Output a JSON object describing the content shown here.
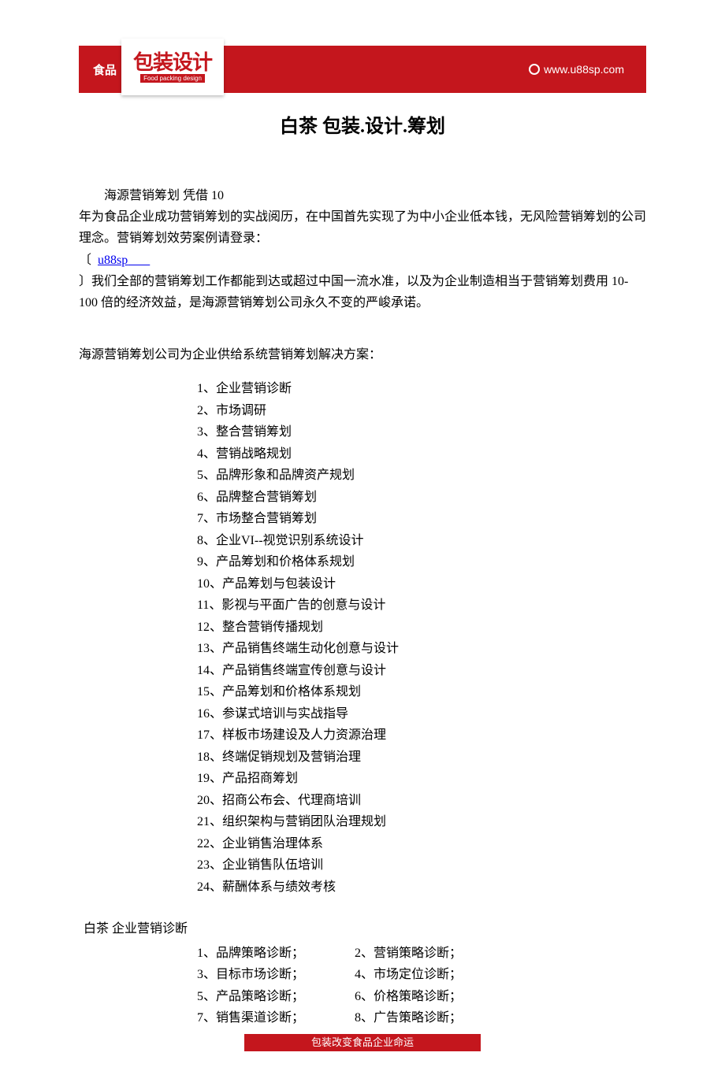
{
  "header": {
    "brand_label": "食品",
    "brand_cn": "包装设计",
    "brand_en": "Food packing design",
    "url": "www.u88sp.com"
  },
  "title": "白茶  包装.设计.筹划",
  "intro": {
    "lead_indent": "海源营销筹划 凭借 10",
    "p1": "年为食品企业成功营销筹划的实战阅历，在中国首先实现了为中小企业低本钱，无风险营销筹划的公司理念。营销筹划效劳案例请登录：",
    "link_open": "〔",
    "link_text": "u88sp",
    "p2": "〕我们全部的营销筹划工作都能到达或超过中国一流水准，以及为企业制造相当于营销筹划费用 10-100 倍的经济效益，是海源营销筹划公司永久不变的严峻承诺。"
  },
  "solutions": {
    "lead": "海源营销筹划公司为企业供给系统营销筹划解决方案：",
    "items": [
      "1、企业营销诊断",
      "2、市场调研",
      "3、整合营销筹划",
      "4、营销战略规划",
      "5、品牌形象和品牌资产规划",
      "6、品牌整合营销筹划",
      "7、市场整合营销筹划",
      "8、企业VI--视觉识别系统设计",
      "9、产品筹划和价格体系规划",
      "10、产品筹划与包装设计",
      "11、影视与平面广告的创意与设计",
      "12、整合营销传播规划",
      "13、产品销售终端生动化创意与设计",
      "14、产品销售终端宣传创意与设计",
      "15、产品筹划和价格体系规划",
      "16、参谋式培训与实战指导",
      "17、样板市场建设及人力资源治理",
      "18、终端促销规划及营销治理",
      "19、产品招商筹划",
      "20、招商公布会、代理商培训",
      "21、组织架构与营销团队治理规划",
      "22、企业销售治理体系",
      "23、企业销售队伍培训",
      "24、薪酬体系与绩效考核"
    ]
  },
  "diagnosis": {
    "title": "白茶  企业营销诊断",
    "rows": [
      [
        "1、品牌策略诊断；",
        "2、营销策略诊断；"
      ],
      [
        "3、目标市场诊断；",
        "4、市场定位诊断；"
      ],
      [
        "5、产品策略诊断；",
        "6、价格策略诊断；"
      ],
      [
        "7、销售渠道诊断；",
        "8、广告策略诊断；"
      ]
    ]
  },
  "footer": "包装改变食品企业命运"
}
